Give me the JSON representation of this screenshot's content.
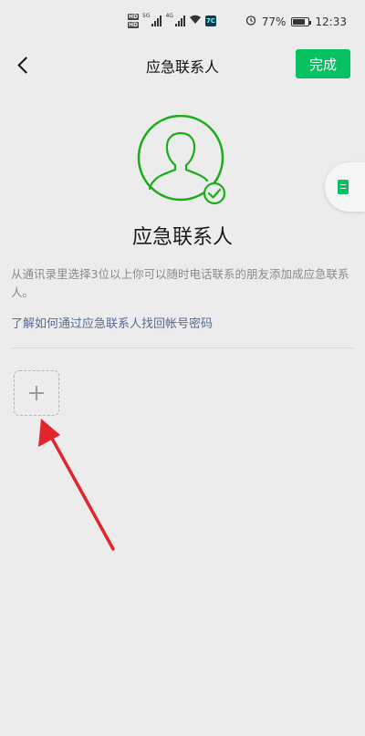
{
  "status_bar": {
    "hd_top": "HD",
    "hd_bottom": "HD",
    "net_1": "5G",
    "net_2": "4G",
    "app_badge": "7C",
    "alarm_icon": "alarm-icon",
    "battery_percent": "77%",
    "battery_level": 0.77,
    "time": "12:33"
  },
  "nav": {
    "back_icon": "chevron-left-icon",
    "title": "应急联系人",
    "done_label": "完成"
  },
  "colors": {
    "accent_green": "#07c160",
    "link_blue": "#576b95",
    "background": "#ececec"
  },
  "main": {
    "avatar_icon": "person-check-icon",
    "heading": "应急联系人",
    "description": "从通讯录里选择3位以上你可以随时电话联系的朋友添加成应急联系人。",
    "help_link": "了解如何通过应急联系人找回帐号密码",
    "add_icon": "plus-icon"
  },
  "floating_tab": {
    "icon": "document-icon"
  },
  "annotation": {
    "icon": "red-arrow-icon"
  }
}
